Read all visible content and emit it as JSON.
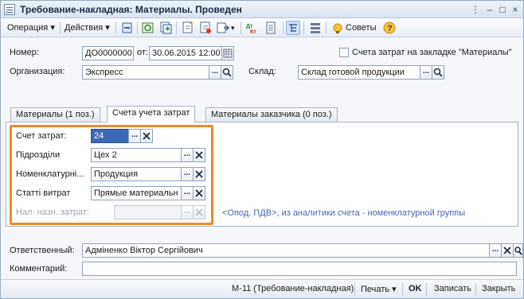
{
  "window": {
    "title": "Требование-накладная: Материалы. Проведен",
    "controls": [
      "⋮",
      "–",
      "□",
      "×"
    ]
  },
  "toolbar": {
    "operation": "Операция",
    "actions": "Действия",
    "tips": "Советы"
  },
  "header": {
    "number_label": "Номер:",
    "number_value": "ДО0000000",
    "from_label": "от:",
    "date_value": "30.06.2015 12:00:",
    "checkbox_label": "Счета затрат на закладке \"Материалы\"",
    "org_label": "Организация:",
    "org_value": "Экспресс",
    "warehouse_label": "Склад:",
    "warehouse_value": "Склад готовой продукции"
  },
  "tabs": [
    {
      "label": "Материалы (1 поз.)"
    },
    {
      "label": "Счета учета затрат"
    },
    {
      "label": "Материалы заказчика (0 поз.)"
    }
  ],
  "accounts": {
    "expense_account_label": "Счет затрат:",
    "expense_account_value": "24",
    "divisions_label": "Підрозділи",
    "divisions_value": "Цех 2",
    "nomenclature_label": "Номенклатурні...",
    "nomenclature_value": "Продукция",
    "cost_items_label": "Статті витрат",
    "cost_items_value": "Прямые материальн",
    "tax_purpose_label": "Нал. назн. затрат:",
    "tax_purpose_value": "",
    "hint": "<Опод. ПДВ>, из аналитики счета - номенклатурной группы"
  },
  "footer": {
    "responsible_label": "Ответственный:",
    "responsible_value": "Адміненко Віктор Сергійович",
    "comment_label": "Комментарий:",
    "comment_value": ""
  },
  "bottom": {
    "form_name": "М-11 (Требование-накладная)",
    "print": "Печать",
    "ok": "OK",
    "write": "Записать",
    "close": "Закрыть"
  },
  "colors": {
    "highlight": "#f08a2a",
    "hint": "#4a63b5"
  }
}
